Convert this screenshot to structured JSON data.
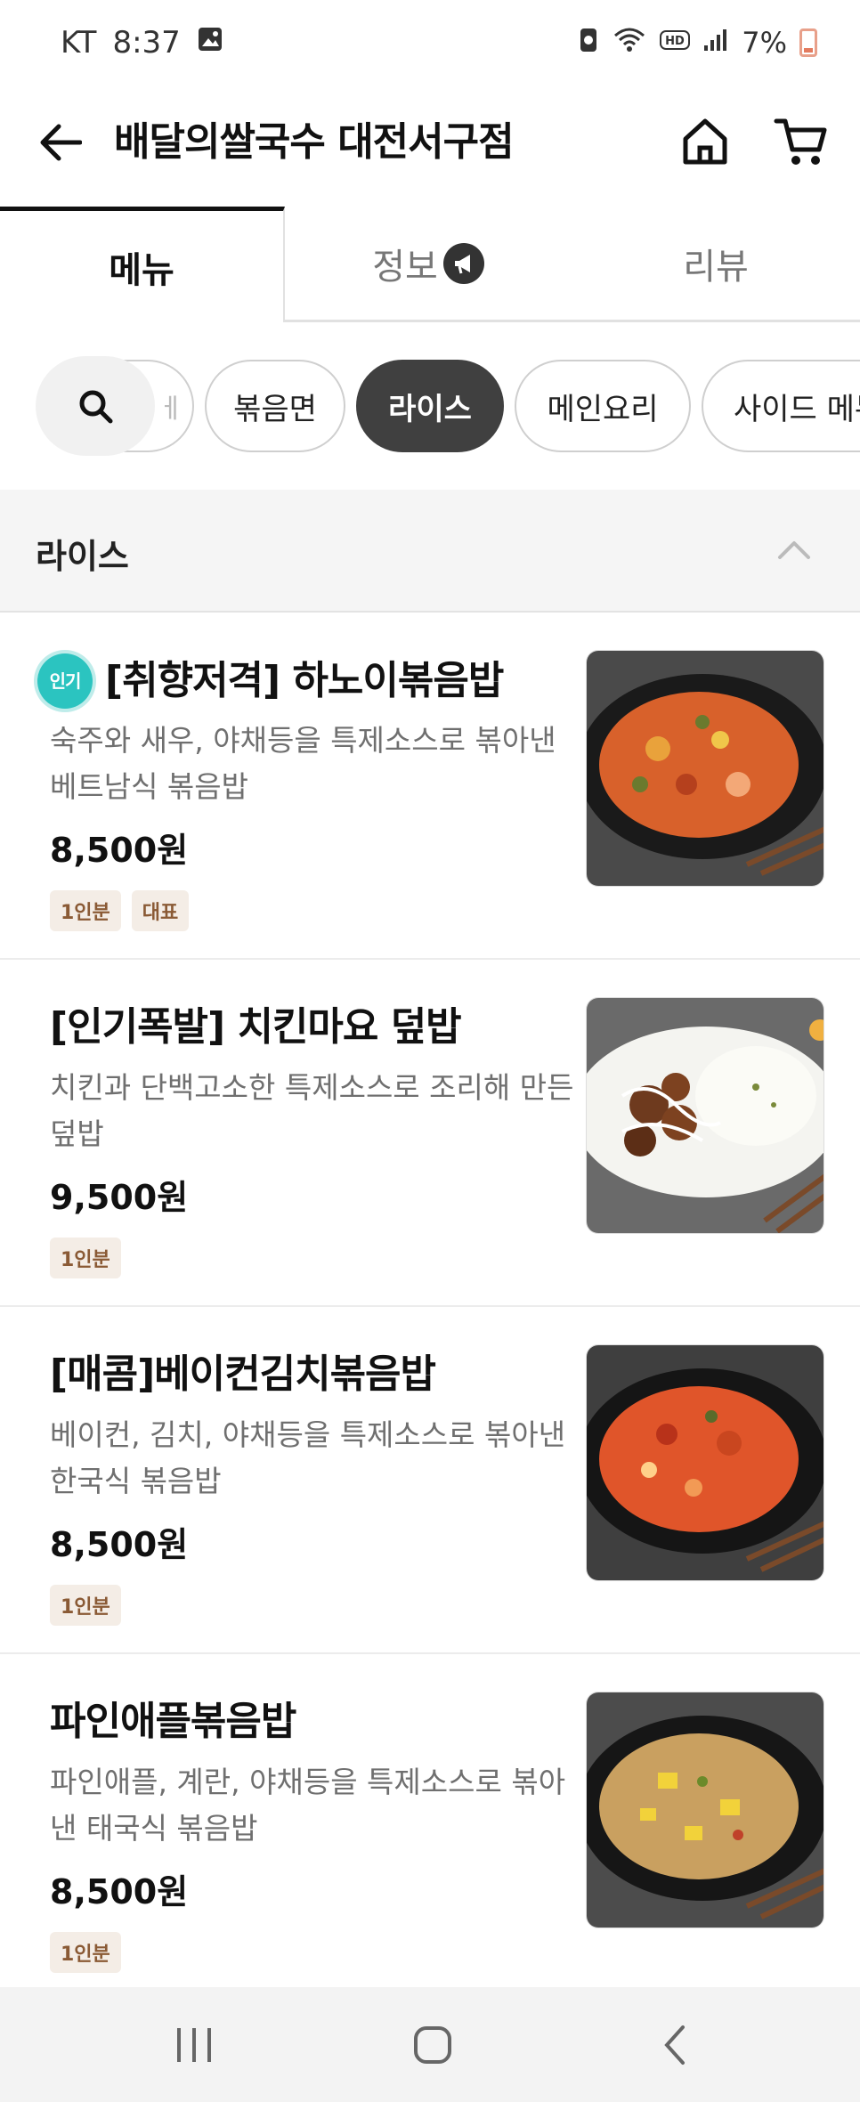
{
  "status_bar": {
    "carrier": "KT",
    "time": "8:37",
    "battery": "7%",
    "icons": [
      "gallery-icon",
      "alarm-icon",
      "wifi-icon",
      "hd-icon",
      "signal-icon",
      "battery-icon"
    ]
  },
  "header": {
    "title": "배달의쌀국수 대전서구점",
    "back_icon": "arrow-left-icon",
    "home_icon": "home-icon",
    "cart_icon": "cart-icon"
  },
  "tabs": [
    {
      "label": "메뉴",
      "active": true
    },
    {
      "label": "정보",
      "active": false
    },
    {
      "label": "리뷰",
      "active": false
    }
  ],
  "categories": {
    "partial_label": "ㅔ",
    "items": [
      {
        "label": "볶음면",
        "active": false
      },
      {
        "label": "라이스",
        "active": true
      },
      {
        "label": "메인요리",
        "active": false
      },
      {
        "label": "사이드 메뉴",
        "active": false
      }
    ]
  },
  "section": {
    "title": "라이스"
  },
  "menu_items": [
    {
      "badge": "인기",
      "name": "[취향저격] 하노이볶음밥",
      "description": "숙주와 새우, 야채등을 특제소스로 볶아낸 베트남식 볶음밥",
      "price": "8,500원",
      "tags": [
        "1인분",
        "대표"
      ]
    },
    {
      "name": "[인기폭발] 치킨마요 덮밥",
      "description": "치킨과 단백고소한 특제소스로 조리해 만든 덮밥",
      "price": "9,500원",
      "tags": [
        "1인분"
      ]
    },
    {
      "name": "[매콤]베이컨김치볶음밥",
      "description": "베이컨, 김치, 야채등을 특제소스로 볶아낸 한국식 볶음밥",
      "price": "8,500원",
      "tags": [
        "1인분"
      ]
    },
    {
      "name": "파인애플볶음밥",
      "description": "파인애플, 계란, 야채등을 특제소스로 볶아낸 태국식 볶음밥",
      "price": "8,500원",
      "tags": [
        "1인분"
      ]
    }
  ],
  "colors": {
    "accent_dark": "#404040",
    "popular_badge": "#2bc4c0",
    "tag_bg": "#f4ede6",
    "tag_text": "#8a5a35"
  }
}
